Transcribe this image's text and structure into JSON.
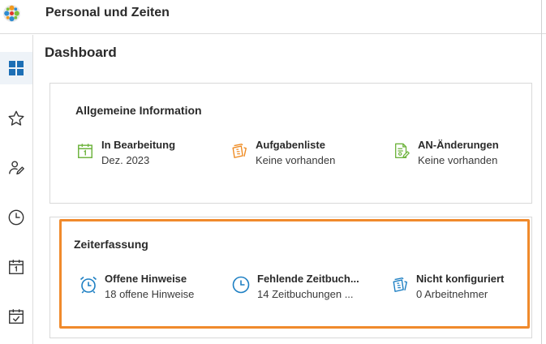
{
  "app": {
    "title": "Personal und Zeiten"
  },
  "sidebar": {
    "items": [
      {
        "icon": "dashboard-icon",
        "active": true
      },
      {
        "icon": "star-icon",
        "active": false
      },
      {
        "icon": "person-edit-icon",
        "active": false
      },
      {
        "icon": "clock-icon",
        "active": false
      },
      {
        "icon": "calendar-icon",
        "active": false
      },
      {
        "icon": "calendar-check-icon",
        "active": false
      }
    ]
  },
  "page": {
    "title": "Dashboard"
  },
  "general": {
    "title": "Allgemeine Information",
    "items": [
      {
        "icon": "calendar-icon",
        "label": "In Bearbeitung",
        "value": "Dez. 2023",
        "color": "#6fb43f"
      },
      {
        "icon": "task-list-icon",
        "label": "Aufgabenliste",
        "value": "Keine vorhanden",
        "color": "#ef8b22"
      },
      {
        "icon": "document-edit-icon",
        "label": "AN-Änderungen",
        "value": "Keine vorhanden",
        "color": "#6fb43f"
      }
    ]
  },
  "time_tracking": {
    "title": "Zeiterfassung",
    "items": [
      {
        "icon": "alarm-clock-icon",
        "label": "Offene Hinweise",
        "value": "18 offene Hinweise",
        "color": "#1d7fc3"
      },
      {
        "icon": "clock-icon",
        "label": "Fehlende Zeitbuch...",
        "value": "14 Zeitbuchungen ...",
        "color": "#1d7fc3"
      },
      {
        "icon": "task-list-icon",
        "label": "Nicht konfiguriert",
        "value": "0 Arbeitnehmer",
        "color": "#1d7fc3"
      }
    ]
  },
  "colors": {
    "accent": "#1d6fb5",
    "highlight": "#f08a2c"
  }
}
